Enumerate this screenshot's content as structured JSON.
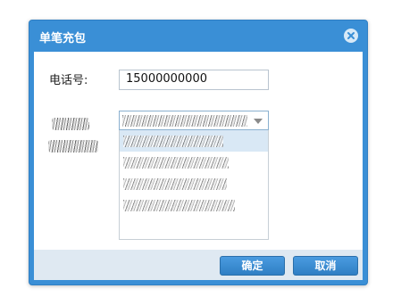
{
  "dialog": {
    "title": "单笔充包",
    "close_icon": "close-icon"
  },
  "form": {
    "phone_label": "电话号:",
    "phone_value": "15000000000"
  },
  "select": {
    "options_count_visible": 4
  },
  "buttons": {
    "confirm_label": "确定",
    "cancel_label": "取消"
  },
  "colors": {
    "titlebar": "#3a8fd6",
    "footer": "#dfe9f2",
    "button": "#3485c9",
    "selected_option": "#d9e8f5"
  }
}
